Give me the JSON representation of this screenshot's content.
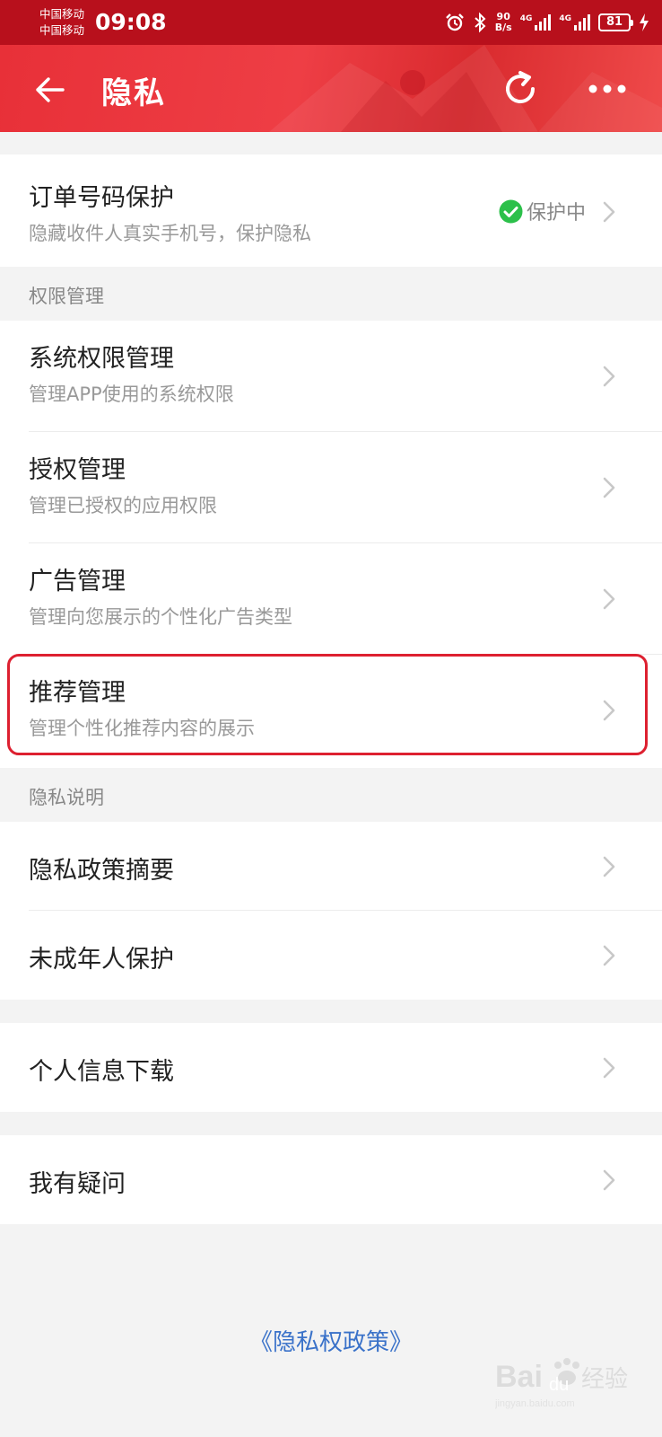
{
  "status_bar": {
    "carrier_1": "中国移动",
    "carrier_2": "中国移动",
    "time": "09:08",
    "net_speed_value": "90",
    "net_speed_unit": "B/s",
    "sig1_type": "4G",
    "sig2_type": "4G",
    "battery": "81"
  },
  "nav": {
    "title": "隐私"
  },
  "order_protect": {
    "title": "订单号码保护",
    "subtitle": "隐藏收件人真实手机号，保护隐私",
    "status": "保护中",
    "status_color": "#2cc04a"
  },
  "permissions": {
    "header": "权限管理",
    "items": [
      {
        "title": "系统权限管理",
        "subtitle": "管理APP使用的系统权限"
      },
      {
        "title": "授权管理",
        "subtitle": "管理已授权的应用权限"
      },
      {
        "title": "广告管理",
        "subtitle": "管理向您展示的个性化广告类型"
      },
      {
        "title": "推荐管理",
        "subtitle": "管理个性化推荐内容的展示"
      }
    ]
  },
  "privacy_notes": {
    "header": "隐私说明",
    "items": [
      {
        "title": "隐私政策摘要"
      },
      {
        "title": "未成年人保护"
      }
    ]
  },
  "download": {
    "title": "个人信息下载"
  },
  "question": {
    "title": "我有疑问"
  },
  "footer": {
    "link": "《隐私权政策》"
  },
  "watermark": {
    "text": "Bai du 经验",
    "url": "jingyan.baidu.com"
  },
  "colors": {
    "brand": "#e83038",
    "highlight": "#dd2030",
    "link": "#3a72c9"
  }
}
